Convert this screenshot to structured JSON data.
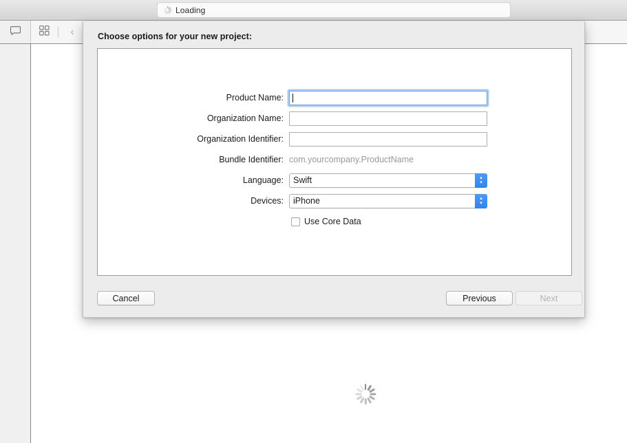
{
  "titlebar": {
    "loading_label": "Loading",
    "spinner_icon": "spinner-icon"
  },
  "toolbar": {
    "comment_icon": "comment-icon",
    "grid_icon": "grid-icon",
    "back_icon": "chevron-left-icon",
    "forward_icon": "chevron-right-icon"
  },
  "editor": {
    "spinner_icon": "spinner-icon"
  },
  "sheet": {
    "title": "Choose options for your new project:",
    "fields": [
      {
        "label": "Product Name:",
        "value": "",
        "type": "text",
        "focused": true
      },
      {
        "label": "Organization Name:",
        "value": "",
        "type": "text",
        "focused": false
      },
      {
        "label": "Organization Identifier:",
        "value": "",
        "type": "text",
        "focused": false
      },
      {
        "label": "Bundle Identifier:",
        "value": "com.yourcompany.ProductName",
        "type": "static",
        "focused": false
      },
      {
        "label": "Language:",
        "value": "Swift",
        "type": "popup",
        "focused": false
      },
      {
        "label": "Devices:",
        "value": "iPhone",
        "type": "popup",
        "focused": false
      }
    ],
    "checkbox": {
      "label": "Use Core Data",
      "checked": false
    },
    "buttons": {
      "cancel": "Cancel",
      "previous": "Previous",
      "next": "Next",
      "next_disabled": true
    },
    "stepper_up": "▴",
    "stepper_down": "▾"
  },
  "colors": {
    "accent_blue": "#2f84ec",
    "focus_ring": "#a9cdf0",
    "sheet_bg": "#ececec",
    "placeholder_text": "#9a9a9a"
  }
}
